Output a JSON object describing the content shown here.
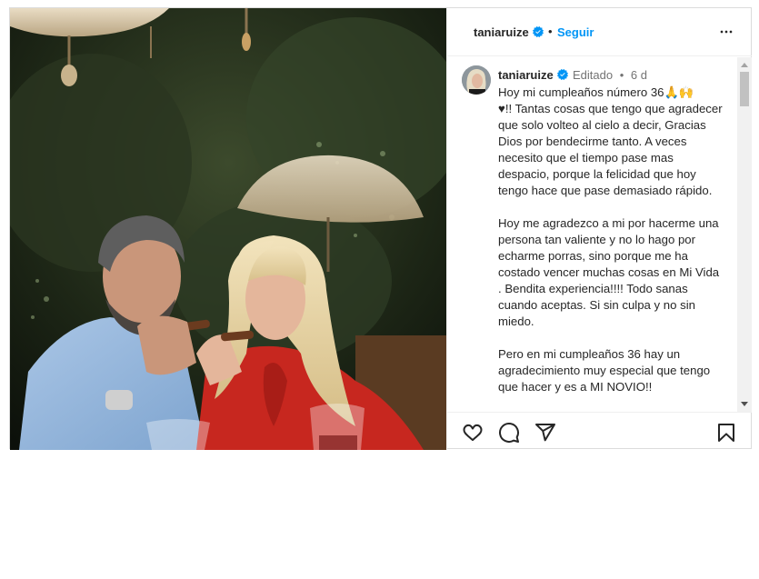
{
  "post": {
    "username": "taniaruize",
    "separator": "•",
    "follow_label": "Seguir",
    "caption": {
      "username": "taniaruize",
      "edited_label": "Editado",
      "separator": "•",
      "time_ago": "6 d",
      "text": "Hoy mi cumpleaños número 36🙏🙌\n♥!! Tantas cosas que tengo que agradecer que solo volteo al cielo a decir, Gracias Dios por bendecirme tanto. A veces necesito que el tiempo pase mas despacio, porque la felicidad que hoy tengo hace que pase demasiado rápido.\n\nHoy me agradezco a mi por hacerme una persona tan valiente y no lo hago por echarme porras, sino porque me ha costado vencer muchas cosas en Mi Vida . Bendita experiencia!!!! Todo sanas cuando aceptas. Si sin culpa y no sin miedo.\n\nPero en mi cumpleaños 36 hay un agradecimiento muy especial que tengo que hacer y es a MI NOVIO!!"
    },
    "icons": {
      "verified": "verified-badge-icon",
      "more": "more-options-icon",
      "like": "heart-icon",
      "comment": "comment-icon",
      "share": "share-icon",
      "save": "bookmark-icon"
    },
    "colors": {
      "follow": "#0095f6",
      "verified": "#0095f6",
      "text": "#262626",
      "muted": "#737373"
    }
  }
}
